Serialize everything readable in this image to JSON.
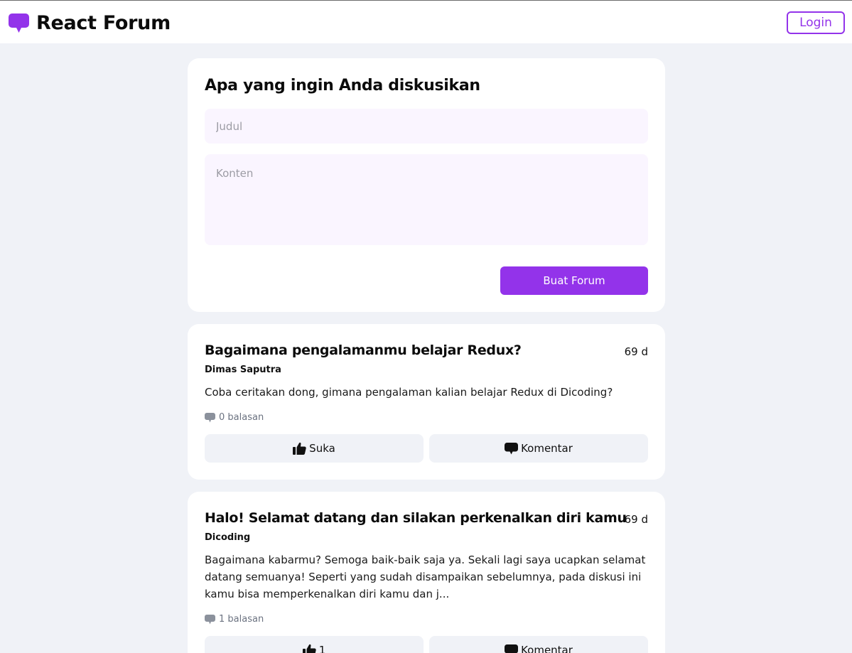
{
  "header": {
    "brand_title": "React Forum",
    "brand_icon": "speech-bubble-icon",
    "login_label": "Login"
  },
  "colors": {
    "accent": "#9333ea",
    "page_background": "#f0f2f7",
    "input_background": "#faf5ff"
  },
  "new_thread_form": {
    "heading": "Apa yang ingin Anda diskusikan",
    "title_placeholder": "Judul",
    "title_value": "",
    "content_placeholder": "Konten",
    "content_value": "",
    "submit_label": "Buat Forum"
  },
  "threads": [
    {
      "title": "Bagaimana pengalamanmu belajar Redux?",
      "age": "69 d",
      "author": "Dimas Saputra",
      "body": "Coba ceritakan dong, gimana pengalaman kalian belajar Redux di Dicoding?",
      "replies": "0 balasan",
      "like_label": "Suka",
      "comment_label": "Komentar"
    },
    {
      "title": "Halo! Selamat datang dan silakan perkenalkan diri kamu",
      "age": "69 d",
      "author": "Dicoding",
      "body": "Bagaimana kabarmu? Semoga baik-baik saja ya. Sekali lagi saya ucapkan selamat datang semuanya! Seperti yang sudah disampaikan sebelumnya, pada diskusi ini kamu bisa memperkenalkan diri kamu dan j...",
      "replies": "1 balasan",
      "like_label": "1",
      "comment_label": "Komentar"
    }
  ]
}
